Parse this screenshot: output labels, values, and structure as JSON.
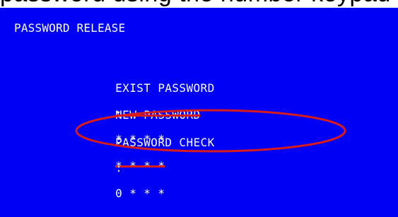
{
  "top_strip": {
    "text": "password using the number keypad"
  },
  "screen": {
    "title": "PASSWORD RELEASE",
    "rows": [
      {
        "label": "EXIST PASSWORD",
        "separator": ":",
        "value": "* * * *"
      },
      {
        "label": "NEW PASSWORD",
        "separator": ":",
        "value": "* * * *"
      },
      {
        "label": "PASSWORD CHECK",
        "separator": ":",
        "value": "0 * * *"
      }
    ]
  },
  "colors": {
    "screen_background": "#0000f4",
    "text": "#ffffff",
    "annotation": "#d81b1b"
  }
}
